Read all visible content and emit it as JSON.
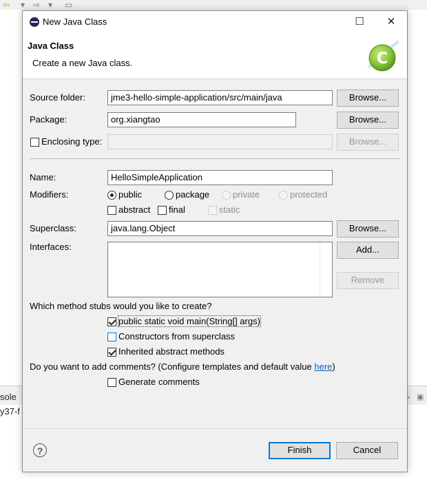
{
  "background": {
    "console_tab": "sole",
    "console_line": "y37-f"
  },
  "dialog": {
    "window_title": "New Java Class",
    "header_title": "Java Class",
    "header_description": "Create a new Java class.",
    "source_folder_label": "Source folder:",
    "source_folder_value": "jme3-hello-simple-application/src/main/java",
    "package_label": "Package:",
    "package_value": "org.xiangtao",
    "enclosing_type_label": "Enclosing type:",
    "enclosing_type_value": "",
    "name_label": "Name:",
    "name_value": "HelloSimpleApplication",
    "modifiers_label": "Modifiers:",
    "modifiers": {
      "public": "public",
      "package": "package",
      "private": "private",
      "protected": "protected",
      "abstract": "abstract",
      "final": "final",
      "static": "static"
    },
    "superclass_label": "Superclass:",
    "superclass_value": "java.lang.Object",
    "interfaces_label": "Interfaces:",
    "buttons": {
      "browse": "Browse...",
      "add": "Add...",
      "remove": "Remove",
      "finish": "Finish",
      "cancel": "Cancel"
    },
    "stubs_question": "Which method stubs would you like to create?",
    "stubs": {
      "main": "public static void main(String[] args)",
      "constructors": "Constructors from superclass",
      "inherited": "Inherited abstract methods"
    },
    "comments_question_prefix": "Do you want to add comments? (Configure templates and default value ",
    "comments_link": "here",
    "comments_question_suffix": ")",
    "generate_comments": "Generate comments",
    "help_symbol": "?"
  },
  "state": {
    "modifier_selected": "public",
    "stub_main_checked": true,
    "stub_constructors_checked": false,
    "stub_inherited_checked": true,
    "generate_comments_checked": false,
    "abstract_checked": false,
    "final_checked": false,
    "enclosing_type_checked": false
  },
  "colors": {
    "dialog_bg": "#f0f0f0",
    "accent": "#0078d7",
    "link": "#0066cc",
    "java_logo": "#8cc63f"
  }
}
